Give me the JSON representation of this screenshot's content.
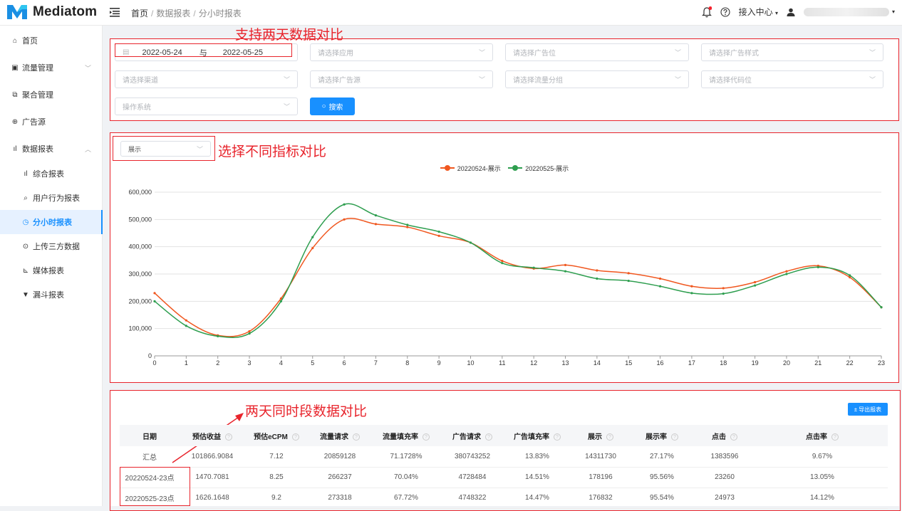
{
  "app": {
    "name": "Mediatom"
  },
  "breadcrumb": [
    "首页",
    "数据报表",
    "分小时报表"
  ],
  "topbar": {
    "access_center": "接入中心"
  },
  "sidebar": {
    "items": [
      {
        "label": "首页",
        "icon": "home-icon"
      },
      {
        "label": "流量管理",
        "icon": "traffic-icon"
      },
      {
        "label": "聚合管理",
        "icon": "aggregate-icon"
      },
      {
        "label": "广告源",
        "icon": "ad-source-icon"
      },
      {
        "label": "数据报表",
        "icon": "report-icon"
      },
      {
        "label": "综合报表",
        "icon": "bar-chart-icon"
      },
      {
        "label": "用户行为报表",
        "icon": "user-search-icon"
      },
      {
        "label": "分小时报表",
        "icon": "clock-icon"
      },
      {
        "label": "上传三方数据",
        "icon": "upload-icon"
      },
      {
        "label": "媒体报表",
        "icon": "area-chart-icon"
      },
      {
        "label": "漏斗报表",
        "icon": "funnel-icon"
      }
    ]
  },
  "filters": {
    "date_start": "2022-05-24",
    "date_sep": "与",
    "date_end": "2022-05-25",
    "app_placeholder": "请选择应用",
    "slot_placeholder": "请选择广告位",
    "style_placeholder": "请选择广告样式",
    "channel_placeholder": "请选择渠道",
    "source_placeholder": "请选择广告源",
    "group_placeholder": "请选择流量分组",
    "code_placeholder": "请选择代码位",
    "os_placeholder": "操作系统",
    "search_label": "搜索"
  },
  "annotations": {
    "compare_days": "支持两天数据对比",
    "compare_metrics": "选择不同指标对比",
    "compare_hours": "两天同时段数据对比"
  },
  "metric_select": {
    "value": "展示"
  },
  "chart_data": {
    "type": "line",
    "x": [
      0,
      1,
      2,
      3,
      4,
      5,
      6,
      7,
      8,
      9,
      10,
      11,
      12,
      13,
      14,
      15,
      16,
      17,
      18,
      19,
      20,
      21,
      22,
      23
    ],
    "ylim": [
      0,
      600000
    ],
    "yticks": [
      "0",
      "100,000",
      "200,000",
      "300,000",
      "400,000",
      "500,000",
      "600,000"
    ],
    "grid": true,
    "legend_position": "top-center",
    "series": [
      {
        "name": "20220524-展示",
        "color": "#f0571f",
        "values": [
          230000,
          130000,
          75000,
          90000,
          210000,
          395000,
          500000,
          483000,
          472000,
          440000,
          415000,
          348000,
          320000,
          333000,
          313000,
          303000,
          283000,
          255000,
          248000,
          270000,
          310000,
          330000,
          288000,
          178000
        ]
      },
      {
        "name": "20220525-展示",
        "color": "#2e9e4f",
        "values": [
          200000,
          110000,
          72000,
          82000,
          200000,
          435000,
          555000,
          515000,
          480000,
          455000,
          415000,
          340000,
          323000,
          310000,
          283000,
          275000,
          255000,
          230000,
          228000,
          258000,
          300000,
          325000,
          295000,
          178000
        ]
      }
    ]
  },
  "export_label": "导出报表",
  "table": {
    "columns": [
      "日期",
      "预估收益",
      "预估eCPM",
      "流量请求",
      "流量填充率",
      "广告请求",
      "广告填充率",
      "展示",
      "展示率",
      "点击",
      "点击率"
    ],
    "rows": [
      [
        "汇总",
        "101866.9084",
        "7.12",
        "20859128",
        "71.1728%",
        "380743252",
        "13.83%",
        "14311730",
        "27.17%",
        "1383596",
        "9.67%"
      ],
      [
        "20220524-23点",
        "1470.7081",
        "8.25",
        "266237",
        "70.04%",
        "4728484",
        "14.51%",
        "178196",
        "95.56%",
        "23260",
        "13.05%"
      ],
      [
        "20220525-23点",
        "1626.1648",
        "9.2",
        "273318",
        "67.72%",
        "4748322",
        "14.47%",
        "176832",
        "95.54%",
        "24973",
        "14.12%"
      ]
    ]
  }
}
